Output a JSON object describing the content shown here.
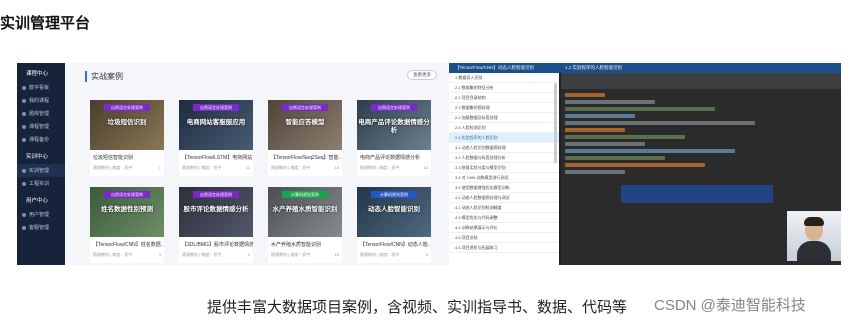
{
  "heading": "实训管理平台",
  "sidebar": {
    "groups": [
      {
        "title": "课程中心",
        "items": [
          "数字看板",
          "我的课程",
          "题库管理",
          "课程管理",
          "课程备份"
        ]
      },
      {
        "title": "实训中心",
        "items": [
          "实训管理",
          "工程实训"
        ]
      },
      {
        "title": "用户中心",
        "items": [
          "用户管理",
          "客服管理"
        ]
      }
    ]
  },
  "main": {
    "title": "实战案例",
    "more_label": "查看更多",
    "cards": [
      {
        "category": "自然语言处理案例",
        "cover": "垃圾短信识别",
        "name": "垃圾短信智能识别",
        "meta": "随课教材 | 难度：初中",
        "count": "1"
      },
      {
        "category": "自然语言处理案例",
        "cover": "电商网站客服服应用",
        "name": "【TensorFlow/LSTM】电商网站…",
        "meta": "随课教材 | 难度：初中",
        "count": "11"
      },
      {
        "category": "自然语言处理案例",
        "cover": "智能应答模型",
        "name": "【TensorFlow/Seq2Seq】智能…",
        "meta": "随课教材 | 难度：初中",
        "count": "16"
      },
      {
        "category": "自然语言处理案例",
        "cover": "电商产品评论数据情感分析",
        "name": "电商产品评论数据情感分析",
        "meta": "随课教材 | 难度：初中",
        "count": "18"
      },
      {
        "category": "自然语言处理案例",
        "cover": "姓名数据性别预测",
        "name": "【TensorFlow/CNN】姓名数据…",
        "meta": "随课教材 | 难度：初中",
        "count": "3"
      },
      {
        "category": "自然语言处理案例",
        "cover": "股市评论数据情感分析",
        "name": "【3DL/BMG】股市评论数据情感…",
        "meta": "随课教材 | 难度：初中",
        "count": "3"
      },
      {
        "category": "计算机视觉案例",
        "cover": "水产养殖水质智能识别",
        "name": "水产养殖水质智能识别",
        "meta": "随课教材 | 难度：初中",
        "count": "18"
      },
      {
        "category": "计算机视觉案例",
        "cover": "动态人脸智能识别",
        "name": "【TensorFlow/CNN】动态人脸…",
        "meta": "随课教材 | 难度：初中",
        "count": "5"
      }
    ]
  },
  "ide": {
    "tab_left": "【TensorFlow/CNN】动态人脸智能识别",
    "tab_right": "1.2 实验程序的人脸智能识别",
    "list": [
      "1 数据导入识别",
      "2.1 数据集的特征分析",
      "2.2 项目目录结构",
      "2.3 数据集的预处理",
      "2.4 加载数据及标签处理",
      "2.5 人脸检测识别",
      "2.6 实验程序的人脸识别",
      "3.1 动态人脸识别数据预处理",
      "3.2 人脸数据与标签处理分析",
      "3.3 修复实验分类与模型识别",
      "3.4 对 CNN 训练模型进行测试",
      "3.5 使用数据增强优化模型训练",
      "4.1 动态人脸数据预处理与测试",
      "4.2 动态人脸识别检测精度",
      "4.3 模型优化与代码调整",
      "4.4 训练结果展示与评价",
      "4.5 项目总结",
      "4.6 项目进阶与拓展练习"
    ],
    "selected_index": 6
  },
  "caption": "提供丰富大数据项目案例，含视频、实训指导书、数据、代码等",
  "watermark": "CSDN @泰迪智能科技"
}
